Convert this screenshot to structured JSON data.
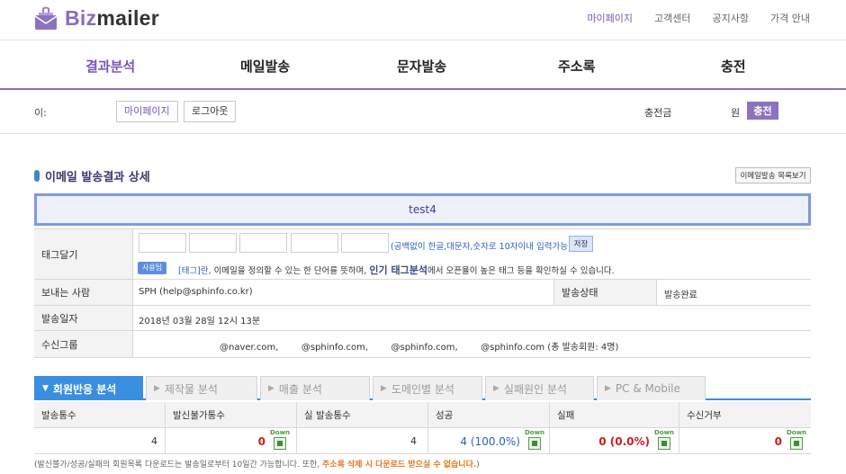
{
  "brand": {
    "name_part1": "Biz",
    "name_part2": "mailer"
  },
  "top_links": [
    "마이페이지",
    "고객센터",
    "공지사항",
    "가격 안내"
  ],
  "main_nav": [
    "결과분석",
    "메일발송",
    "문자발송",
    "주소록",
    "충전"
  ],
  "subbar": {
    "id_label": "이:",
    "mypage_button": "마이페이지",
    "logout_button": "로그아웃",
    "charge_label": "충전금",
    "won_label": "원",
    "charge_button": "충전"
  },
  "section": {
    "title": "이메일 발송결과 상세",
    "list_button": "이메일발송 목록보기",
    "mail_title": "test4"
  },
  "tag": {
    "label": "태그달기",
    "hint": "(공백없이 한글,대문자,숫자로 10자이내 입력가능)",
    "save_button": "저장",
    "usage_badge": "사용팁",
    "desc_part1": "[태그]란,",
    "desc_part2": " 이메일을 정의할 수 있는 한 단어를 뜻하며, ",
    "desc_part3": "인기 태그분석",
    "desc_part4": "에서 오픈율이 높은 태그 등을 확인하실 수 있습니다."
  },
  "info": {
    "sender_label": "보내는 사람",
    "sender_value": "SPH (help@sphinfo.co.kr)",
    "status_label": "발송상태",
    "status_value": "발송완료",
    "date_label": "발송일자",
    "date_value": "2018년 03월 28일 12시 13분",
    "group_label": "수신그룹",
    "group_value": "@naver.com,        @sphinfo.com,        @sphinfo.com,        @sphinfo.com (총 발송회원: 4명)"
  },
  "tabs": [
    "회원반응 분석",
    "제작물 분석",
    "매출 분석",
    "도메인별 분석",
    "실패원인 분석",
    "PC & Mobile"
  ],
  "stats": {
    "headers": [
      "발송통수",
      "발신불가통수",
      "실 발송통수",
      "성공",
      "실패",
      "수신거부"
    ],
    "values": [
      "4",
      "0",
      "4",
      "4 (100.0%)",
      "0 (0.0%)",
      "0"
    ],
    "down_label": "Down"
  },
  "footnote": {
    "part1": "(발신불가/성공/실패의 회원목록 다운로드는 발송일로부터 10일간 가능합니다. 또한, ",
    "part2": "주소록 삭제 시 다운로드 받으실 수 없습니다.",
    "part3": ")"
  },
  "colors": {
    "brand_purple": "#8d72c0",
    "tab_blue": "#3a8ee0",
    "fail_red": "#d21b1b",
    "success_blue": "#2a62b8"
  }
}
